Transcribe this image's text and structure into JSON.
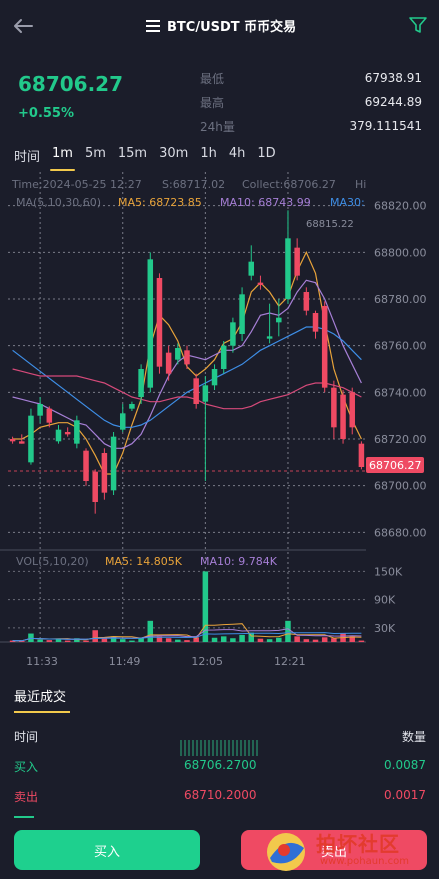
{
  "header": {
    "title": "BTC/USDT 币币交易"
  },
  "ticker": {
    "last_price": "68706.27",
    "change": "+0.55%",
    "stats": [
      {
        "label": "最低",
        "value": "67938.91"
      },
      {
        "label": "最高",
        "value": "69244.89"
      },
      {
        "label": "24h量",
        "value": "379.111541"
      }
    ]
  },
  "intervals": [
    {
      "label": "时间",
      "active": false
    },
    {
      "label": "1m",
      "active": true
    },
    {
      "label": "5m",
      "active": false
    },
    {
      "label": "15m",
      "active": false
    },
    {
      "label": "30m",
      "active": false
    },
    {
      "label": "1h",
      "active": false
    },
    {
      "label": "4h",
      "active": false
    },
    {
      "label": "1D",
      "active": false
    }
  ],
  "chart_info": {
    "time": "Time:2024-05-25 12:27",
    "s": "S:68717.02",
    "collect": "Collect:68706.27",
    "hi": "Hi",
    "ma_label": "MA(5,10,30,60)",
    "ma5": "MA5: 68723.85",
    "ma10": "MA10: 68743.99",
    "ma30": "MA30:",
    "peak_label": "68815.22",
    "current_price_tag": "68706.27"
  },
  "colors": {
    "up": "#22c98b",
    "down": "#ef4a63",
    "ma5": "#e8a33a",
    "ma10": "#a67fd6",
    "ma30": "#3e8ee6",
    "ma60": "#d64a7a",
    "accent": "#f2c94c"
  },
  "volume_info": {
    "label": "VOL(5,10,20)",
    "ma5": "MA5: 14.805K",
    "ma10": "MA10: 9.784K"
  },
  "chart_data": [
    {
      "type": "candlestick",
      "y_ticks": [
        "68820.00",
        "68800.00",
        "68780.00",
        "68760.00",
        "68740.00",
        "68720.00",
        "68700.00",
        "68680.00"
      ],
      "ylim": [
        68675,
        68825
      ],
      "x_ticks": [
        "11:33",
        "11:49",
        "12:05",
        "12:21"
      ],
      "candles": [
        {
          "o": 68720,
          "h": 68721,
          "l": 68718,
          "c": 68719
        },
        {
          "o": 68719,
          "h": 68722,
          "l": 68718,
          "c": 68718
        },
        {
          "o": 68710,
          "h": 68733,
          "l": 68709,
          "c": 68730
        },
        {
          "o": 68730,
          "h": 68738,
          "l": 68727,
          "c": 68735
        },
        {
          "o": 68733,
          "h": 68734,
          "l": 68725,
          "c": 68727
        },
        {
          "o": 68719,
          "h": 68726,
          "l": 68718,
          "c": 68724
        },
        {
          "o": 68723,
          "h": 68725,
          "l": 68721,
          "c": 68722
        },
        {
          "o": 68718,
          "h": 68730,
          "l": 68716,
          "c": 68728
        },
        {
          "o": 68715,
          "h": 68716,
          "l": 68700,
          "c": 68702
        },
        {
          "o": 68706,
          "h": 68707,
          "l": 68688,
          "c": 68693
        },
        {
          "o": 68714,
          "h": 68716,
          "l": 68694,
          "c": 68697
        },
        {
          "o": 68698,
          "h": 68723,
          "l": 68696,
          "c": 68721
        },
        {
          "o": 68724,
          "h": 68735,
          "l": 68723,
          "c": 68731
        },
        {
          "o": 68733,
          "h": 68736,
          "l": 68732,
          "c": 68735
        },
        {
          "o": 68738,
          "h": 68752,
          "l": 68735,
          "c": 68750
        },
        {
          "o": 68742,
          "h": 68800,
          "l": 68740,
          "c": 68797
        },
        {
          "o": 68789,
          "h": 68791,
          "l": 68748,
          "c": 68751
        },
        {
          "o": 68757,
          "h": 68760,
          "l": 68745,
          "c": 68748
        },
        {
          "o": 68754,
          "h": 68761,
          "l": 68752,
          "c": 68759
        },
        {
          "o": 68758,
          "h": 68760,
          "l": 68750,
          "c": 68752
        },
        {
          "o": 68746,
          "h": 68748,
          "l": 68733,
          "c": 68735
        },
        {
          "o": 68736,
          "h": 68747,
          "l": 68702,
          "c": 68743
        },
        {
          "o": 68743,
          "h": 68752,
          "l": 68741,
          "c": 68750
        },
        {
          "o": 68750,
          "h": 68762,
          "l": 68748,
          "c": 68760
        },
        {
          "o": 68760,
          "h": 68772,
          "l": 68757,
          "c": 68770
        },
        {
          "o": 68765,
          "h": 68785,
          "l": 68762,
          "c": 68782
        },
        {
          "o": 68790,
          "h": 68803,
          "l": 68788,
          "c": 68796
        },
        {
          "o": 68787,
          "h": 68790,
          "l": 68784,
          "c": 68786
        },
        {
          "o": 68763,
          "h": 68778,
          "l": 68761,
          "c": 68764
        },
        {
          "o": 68770,
          "h": 68780,
          "l": 68764,
          "c": 68772
        },
        {
          "o": 68780,
          "h": 68818,
          "l": 68778,
          "c": 68806
        },
        {
          "o": 68802,
          "h": 68806,
          "l": 68788,
          "c": 68790
        },
        {
          "o": 68783,
          "h": 68785,
          "l": 68773,
          "c": 68775
        },
        {
          "o": 68774,
          "h": 68775,
          "l": 68763,
          "c": 68766
        },
        {
          "o": 68777,
          "h": 68779,
          "l": 68740,
          "c": 68742
        },
        {
          "o": 68742,
          "h": 68745,
          "l": 68720,
          "c": 68725
        },
        {
          "o": 68739,
          "h": 68741,
          "l": 68718,
          "c": 68720
        },
        {
          "o": 68740,
          "h": 68742,
          "l": 68722,
          "c": 68725
        },
        {
          "o": 68718,
          "h": 68719,
          "l": 68707,
          "c": 68708
        }
      ],
      "ma_series": [
        {
          "name": "MA5",
          "values": [
            68720,
            68720,
            68722,
            68725,
            68726,
            68727,
            68727,
            68725,
            68720,
            68713,
            68705,
            68705,
            68714,
            68726,
            68737,
            68760,
            68773,
            68769,
            68762,
            68751,
            68747,
            68750,
            68754,
            68761,
            68763,
            68770,
            68783,
            68787,
            68783,
            68777,
            68781,
            68792,
            68800,
            68791,
            68770,
            68750,
            68738,
            68728,
            68720
          ]
        },
        {
          "name": "MA10",
          "values": [
            68738,
            68737,
            68736,
            68735,
            68733,
            68731,
            68729,
            68727,
            68726,
            68722,
            68718,
            68716,
            68716,
            68718,
            68722,
            68730,
            68739,
            68747,
            68753,
            68756,
            68755,
            68754,
            68756,
            68758,
            68758,
            68760,
            68766,
            68773,
            68774,
            68773,
            68776,
            68783,
            68788,
            68787,
            68780,
            68770,
            68760,
            68752,
            68744
          ]
        },
        {
          "name": "MA30",
          "values": [
            68758,
            68755,
            68752,
            68749,
            68746,
            68743,
            68740,
            68737,
            68734,
            68731,
            68728,
            68726,
            68725,
            68725,
            68726,
            68728,
            68731,
            68734,
            68737,
            68740,
            68742,
            68744,
            68746,
            68748,
            68750,
            68752,
            68755,
            68758,
            68760,
            68762,
            68764,
            68766,
            68768,
            68768,
            68767,
            68765,
            68762,
            68758,
            68754
          ]
        },
        {
          "name": "MA60",
          "values": [
            68750,
            68749,
            68748,
            68747,
            68747,
            68747,
            68747,
            68747,
            68746,
            68745,
            68744,
            68742,
            68740,
            68738,
            68737,
            68736,
            68736,
            68737,
            68738,
            68738,
            68737,
            68735,
            68734,
            68733,
            68733,
            68733,
            68734,
            68736,
            68737,
            68738,
            68739,
            68741,
            68743,
            68744,
            68744,
            68743,
            68742,
            68740,
            68738
          ]
        }
      ]
    },
    {
      "type": "bar",
      "title": "VOL(5,10,20)",
      "y_ticks": [
        "150K",
        "90K",
        "30K"
      ],
      "ylim": [
        0,
        170000
      ],
      "volumes": [
        3000,
        2000,
        18000,
        5000,
        4000,
        6000,
        3000,
        8000,
        3000,
        25000,
        10000,
        12000,
        6000,
        3000,
        9000,
        45000,
        12000,
        8000,
        5000,
        4000,
        10000,
        150000,
        9000,
        12000,
        8000,
        15000,
        20000,
        7000,
        6000,
        9000,
        45000,
        12000,
        6000,
        5000,
        10000,
        8000,
        18000,
        12000,
        3000
      ]
    }
  ],
  "trades": {
    "title": "最近成交",
    "col_time": "时间",
    "col_qty": "数量",
    "rows": [
      {
        "side": "买入",
        "price": "68706.2700",
        "qty": "0.0087",
        "type": "buy"
      },
      {
        "side": "卖出",
        "price": "68710.2000",
        "qty": "0.0017",
        "type": "sell"
      }
    ]
  },
  "actions": {
    "buy": "买入",
    "sell": "卖出"
  },
  "watermark": {
    "text": "拍坏社区",
    "url": "www.pohaun.com"
  }
}
